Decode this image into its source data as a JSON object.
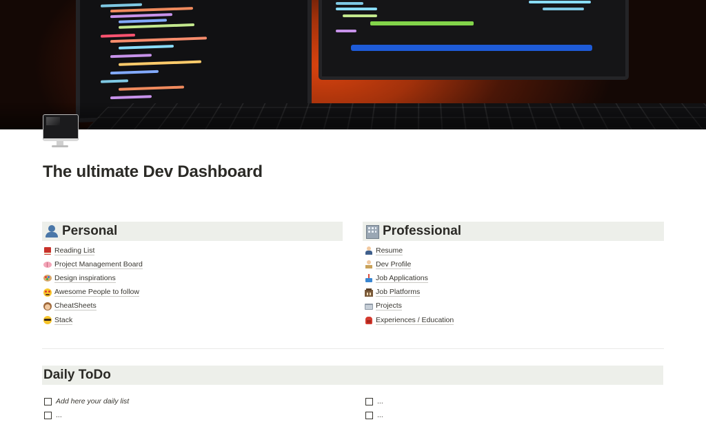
{
  "page": {
    "title": "The ultimate Dev Dashboard",
    "cover_image": "dev-monitors-keyboard-photo",
    "page_icon": "desktop-computer-icon"
  },
  "personal": {
    "title": "Personal",
    "icon": "bust-in-silhouette-icon",
    "items": [
      {
        "icon": "red-book-icon",
        "label": "Reading List"
      },
      {
        "icon": "brain-icon",
        "label": "Project Management Board"
      },
      {
        "icon": "palette-icon",
        "label": "Design inspirations"
      },
      {
        "icon": "star-struck-face-icon",
        "label": "Awesome People to follow"
      },
      {
        "icon": "monkey-face-icon",
        "label": "CheatSheets"
      },
      {
        "icon": "nerd-face-icon",
        "label": "Stack"
      }
    ]
  },
  "professional": {
    "title": "Professional",
    "icon": "office-building-icon",
    "items": [
      {
        "icon": "man-office-worker-icon",
        "label": "Resume"
      },
      {
        "icon": "technologist-icon",
        "label": "Dev Profile"
      },
      {
        "icon": "inbox-tray-icon",
        "label": "Job Applications"
      },
      {
        "icon": "classical-building-icon",
        "label": "Job Platforms"
      },
      {
        "icon": "folder-icon",
        "label": "Projects"
      },
      {
        "icon": "backpack-icon",
        "label": "Experiences / Education"
      }
    ]
  },
  "todo": {
    "title": "Daily ToDo",
    "left": [
      {
        "label": "Add here your daily list",
        "checked": false
      },
      {
        "label": "...",
        "checked": false
      }
    ],
    "right": [
      {
        "label": "...",
        "checked": false
      },
      {
        "label": "...",
        "checked": false
      }
    ]
  },
  "colors": {
    "header_bg": "#edefea",
    "text": "#37352f",
    "cover_glow": "#d8430f"
  }
}
